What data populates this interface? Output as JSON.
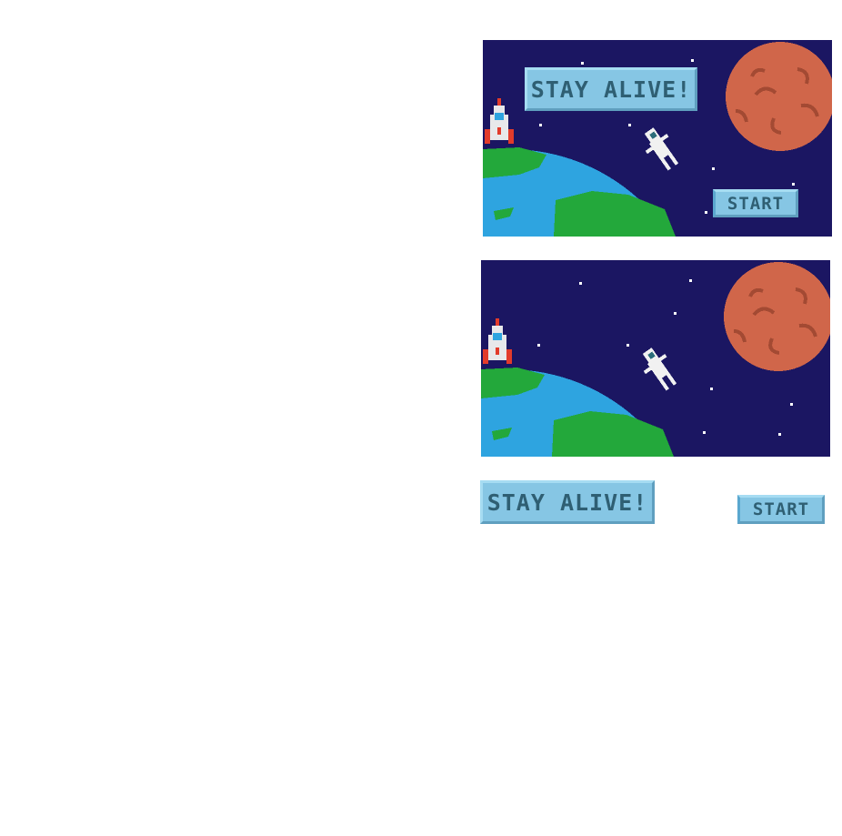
{
  "colors": {
    "space": "#1b1662",
    "ocean": "#2ea4e0",
    "land": "#23a83b",
    "planet": "#d0664a",
    "planet_dark": "#a34a33",
    "star": "#ffffff",
    "button_fill": "#86c6e4",
    "button_text": "#2f5f73"
  },
  "game": {
    "title_label": "STAY ALIVE!",
    "start_label": "START"
  },
  "assets": {
    "title_label": "STAY ALIVE!",
    "start_label": "START"
  },
  "icons": [
    "rocket-icon",
    "astronaut-icon",
    "earth-planet",
    "mars-planet",
    "star-icon"
  ]
}
